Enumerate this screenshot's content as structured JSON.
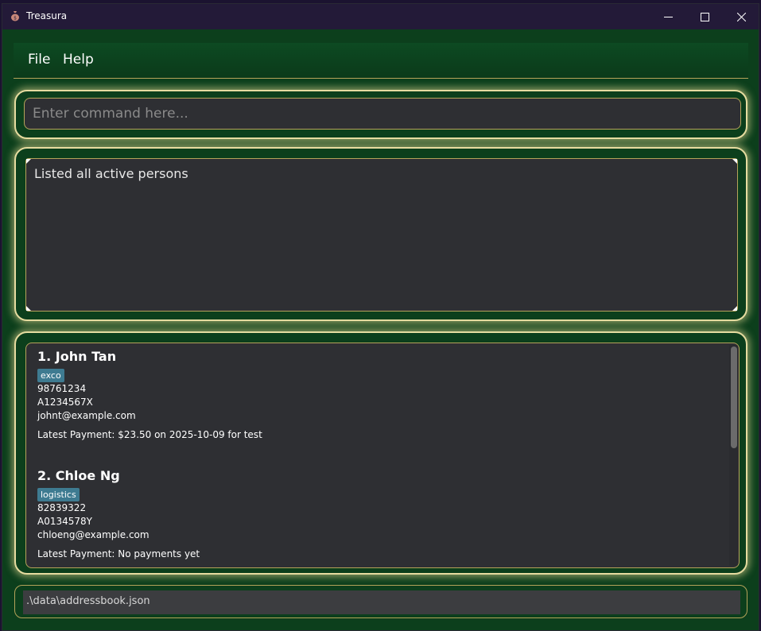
{
  "window": {
    "title": "Treasura",
    "icon": "money-bag-icon"
  },
  "menu": {
    "file": "File",
    "help": "Help"
  },
  "command": {
    "placeholder": "Enter command here...",
    "value": ""
  },
  "result": {
    "message": "Listed all active persons"
  },
  "persons": [
    {
      "index_name": "1.  John Tan",
      "tag": "exco",
      "phone": "98761234",
      "id": "A1234567X",
      "email": "johnt@example.com",
      "payment": "Latest Payment: $23.50 on 2025-10-09 for test"
    },
    {
      "index_name": "2.  Chloe Ng",
      "tag": "logistics",
      "phone": "82839322",
      "id": "A0134578Y",
      "email": "chloeng@example.com",
      "payment": "Latest Payment: No payments yet"
    }
  ],
  "status": {
    "path": ".\\data\\addressbook.json"
  },
  "colors": {
    "background": "#0c3f1c",
    "panel_border": "#e6dca0",
    "box": "#2e2f33",
    "tag": "#3e7b91",
    "titlebar": "#231a38"
  }
}
